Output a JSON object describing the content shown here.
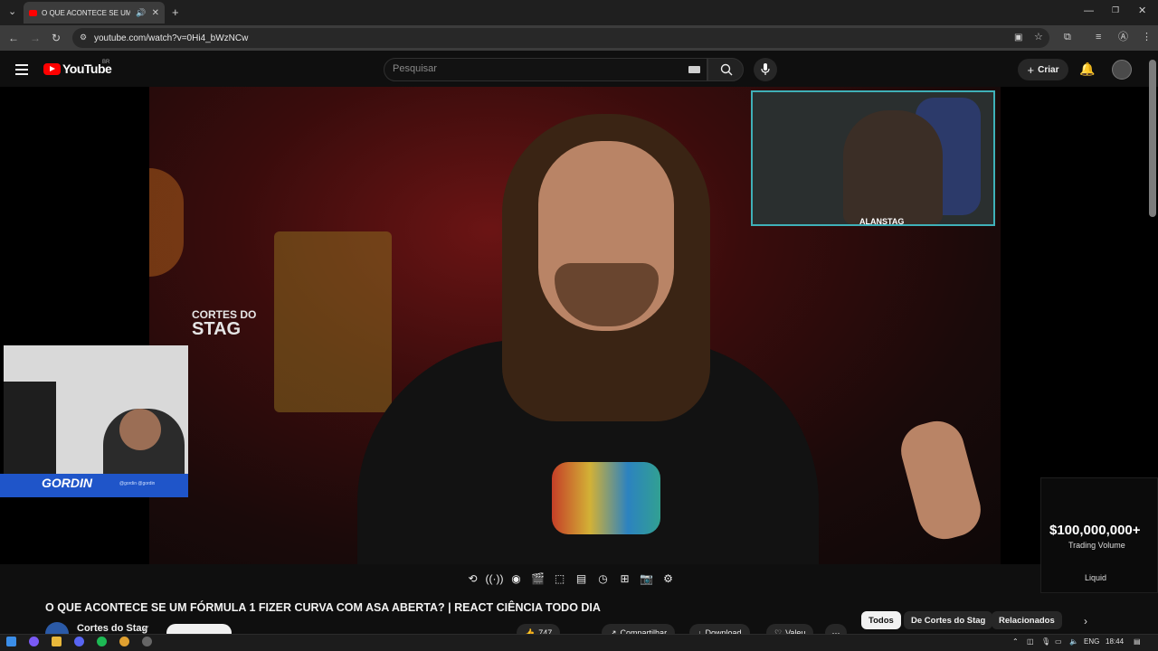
{
  "browser": {
    "tab_title": "O QUE ACONTECE SE UM F",
    "url": "youtube.com/watch?v=0Hi4_bWzNCw"
  },
  "youtube": {
    "logo": "YouTube",
    "country": "BR",
    "search_placeholder": "Pesquisar",
    "create_label": "Criar"
  },
  "video": {
    "overlay_top_cam_tag": "ALANSTAG",
    "overlay_watermark_line1": "CORTES DO",
    "overlay_watermark_line2": "STAG",
    "overlay_left_cam_name": "GORDIN",
    "overlay_left_cam_handles": "@gordin @gordin"
  },
  "ad": {
    "amount": "$100,000,000+",
    "label": "Trading Volume",
    "brand": "Liquid"
  },
  "watch": {
    "title": "O QUE ACONTECE SE UM FÓRMULA 1 FIZER CURVA COM ASA ABERTA? | REACT CIÊNCIA TODO DIA",
    "channel": "Cortes do Stag",
    "like_count": "747",
    "share_label": "Compartilhar",
    "download_label": "Download",
    "thanks_label": "Valeu"
  },
  "chips": [
    "Todos",
    "De Cortes do Stag",
    "Relacionados"
  ],
  "taskbar": {
    "lang": "ENG",
    "time": "18:44"
  },
  "colors": {
    "brand_red": "#ff0000",
    "background": "#0f0f0f",
    "chip_active": "#f1f1f1"
  }
}
